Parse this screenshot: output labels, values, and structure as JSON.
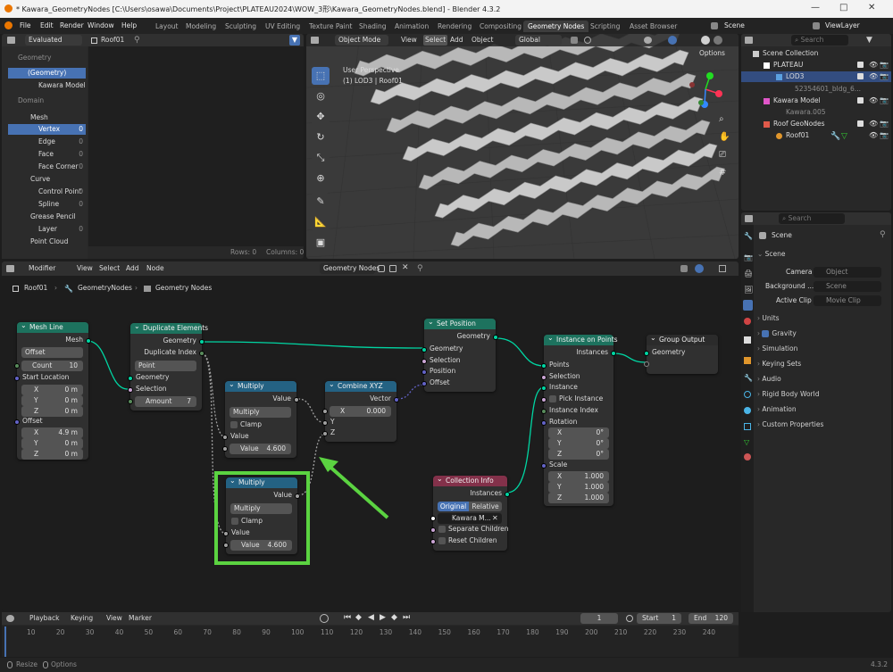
{
  "window": {
    "title": "* Kawara_GeometryNodes [C:\\Users\\osawa\\Documents\\Project\\PLATEAU2024\\WOW_3形\\Kawara_GeometryNodes.blend] - Blender 4.3.2",
    "minimize": "—",
    "maximize": "□",
    "close": "✕"
  },
  "menu": {
    "items": [
      "File",
      "Edit",
      "Render",
      "Window",
      "Help"
    ],
    "tabs": [
      "Layout",
      "Modeling",
      "Sculpting",
      "UV Editing",
      "Texture Paint",
      "Shading",
      "Animation",
      "Rendering",
      "Compositing",
      "Geometry Nodes",
      "Scripting",
      "Asset Browser"
    ],
    "active_tab": "Geometry Nodes",
    "scene": "Scene",
    "view_layer": "ViewLayer"
  },
  "spreadsheet": {
    "mode": "Evaluated",
    "object": "Roof01",
    "geometry_label": "Geometry",
    "geometry_item": "(Geometry)",
    "model_item": "Kawara Model",
    "domain_label": "Domain",
    "mesh": "Mesh",
    "mesh_items": [
      {
        "label": "Vertex",
        "count": "0"
      },
      {
        "label": "Edge",
        "count": "0"
      },
      {
        "label": "Face",
        "count": "0"
      },
      {
        "label": "Face Corner",
        "count": "0"
      }
    ],
    "curve": "Curve",
    "curve_items": [
      {
        "label": "Control Point",
        "count": "0"
      },
      {
        "label": "Spline",
        "count": "0"
      }
    ],
    "grease": "Grease Pencil",
    "grease_items": [
      {
        "label": "Layer",
        "count": "0"
      }
    ],
    "pointcloud": "Point Cloud",
    "rows": "Rows: 0",
    "columns": "Columns: 0"
  },
  "viewport": {
    "mode": "Object Mode",
    "menus": [
      "View",
      "Select",
      "Add",
      "Object"
    ],
    "transform": "Global",
    "options": "Options",
    "perspective": "User Perspective",
    "collection": "(1) LOD3 | Roof01"
  },
  "outliner": {
    "search": "Search",
    "items": [
      {
        "label": "Scene Collection"
      },
      {
        "label": "PLATEAU"
      },
      {
        "label": "LOD3"
      },
      {
        "label": "52354601_bldg_6..."
      },
      {
        "label": "Kawara Model"
      },
      {
        "label": "Kawara.005"
      },
      {
        "label": "Roof GeoNodes"
      },
      {
        "label": "Roof01"
      }
    ]
  },
  "properties": {
    "search": "Search",
    "scene": "Scene",
    "scene_section": "Scene",
    "camera_label": "Camera",
    "camera_value": "Object",
    "background_label": "Background ...",
    "background_value": "Scene",
    "clip_label": "Active Clip",
    "clip_value": "Movie Clip",
    "sections": [
      "Units",
      "Gravity",
      "Simulation",
      "Keying Sets",
      "Audio",
      "Rigid Body World",
      "Animation",
      "Custom Properties"
    ]
  },
  "node_editor": {
    "menus": [
      "Modifier",
      "View",
      "Select",
      "Add",
      "Node"
    ],
    "tree": "Geometry Nodes",
    "breadcrumb": [
      "Roof01",
      "GeometryNodes",
      "Geometry Nodes"
    ],
    "mesh_line": {
      "title": "Mesh Line",
      "out": "Mesh",
      "mode": "Offset",
      "count_label": "Count",
      "count": "10",
      "start_label": "Start Location",
      "sx": "0 m",
      "sy": "0 m",
      "sz": "0 m",
      "offset_label": "Offset",
      "ox": "4.9 m",
      "oy": "0 m",
      "oz": "0 m",
      "x": "X",
      "y": "Y",
      "z": "Z"
    },
    "duplicate": {
      "title": "Duplicate Elements",
      "out1": "Geometry",
      "out2": "Duplicate Index",
      "domain": "Point",
      "in1": "Geometry",
      "in2": "Selection",
      "amount_label": "Amount",
      "amount": "7"
    },
    "multiply1": {
      "title": "Multiply",
      "out": "Value",
      "op": "Multiply",
      "clamp": "Clamp",
      "in": "Value",
      "field_label": "Value",
      "field": "4.600"
    },
    "multiply2": {
      "title": "Multiply",
      "out": "Value",
      "op": "Multiply",
      "clamp": "Clamp",
      "in": "Value",
      "field_label": "Value",
      "field": "4.600"
    },
    "combine": {
      "title": "Combine XYZ",
      "out": "Vector",
      "x_label": "X",
      "x": "0.000",
      "y": "Y",
      "z": "Z"
    },
    "set_position": {
      "title": "Set Position",
      "out": "Geometry",
      "in1": "Geometry",
      "in2": "Selection",
      "in3": "Position",
      "in4": "Offset"
    },
    "instance": {
      "title": "Instance on Points",
      "out": "Instances",
      "in1": "Points",
      "in2": "Selection",
      "in3": "Instance",
      "pick": "Pick Instance",
      "idx": "Instance Index",
      "rot": "Rotation",
      "rx": "0°",
      "ry": "0°",
      "rz": "0°",
      "scale": "Scale",
      "scx": "1.000",
      "scy": "1.000",
      "scz": "1.000",
      "x": "X",
      "y": "Y",
      "z": "Z"
    },
    "group_output": {
      "title": "Group Output",
      "in": "Geometry"
    },
    "collection_info": {
      "title": "Collection Info",
      "out": "Instances",
      "original": "Original",
      "relative": "Relative",
      "collection": "Kawara M...",
      "sep": "Separate Children",
      "reset": "Reset Children"
    }
  },
  "timeline": {
    "menus": [
      "Playback",
      "Keying",
      "View",
      "Marker"
    ],
    "frame": "1",
    "start_label": "Start",
    "start": "1",
    "end_label": "End",
    "end": "120",
    "ticks": [
      "10",
      "20",
      "30",
      "40",
      "50",
      "60",
      "70",
      "80",
      "90",
      "100",
      "110",
      "120",
      "130",
      "140",
      "150",
      "160",
      "170",
      "180",
      "190",
      "200",
      "210",
      "220",
      "230",
      "240"
    ]
  },
  "status": {
    "resize": "Resize",
    "options": "Options",
    "version": "4.3.2"
  },
  "colors": {
    "accent": "#4772b3",
    "highlight": "#5bd341",
    "geo_socket": "#00d6a3",
    "geo_node": "#1d725e",
    "input_node": "#83314a",
    "converter_node": "#246283"
  }
}
